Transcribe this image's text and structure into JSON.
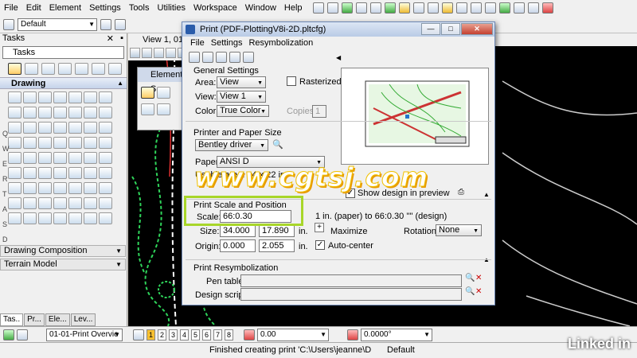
{
  "menubar": {
    "items": [
      "File",
      "Edit",
      "Element",
      "Settings",
      "Tools",
      "Utilities",
      "Workspace",
      "Window",
      "Help"
    ]
  },
  "toolbar": {
    "level_combo": "Default"
  },
  "tasks_panel": {
    "title": "Tasks",
    "combo": "Tasks",
    "section_drawing": "Drawing",
    "section_drawing_composition": "Drawing Composition",
    "section_terrain_model": "Terrain Model",
    "row_letters": [
      "Q",
      "W",
      "E",
      "R",
      "T",
      "A",
      "S",
      "D",
      "F"
    ],
    "tabs": [
      "Tas..",
      "Pr...",
      "Ele...",
      "Lev..."
    ]
  },
  "view": {
    "title": "View 1, 01-0"
  },
  "element_selection": {
    "title": "Element S"
  },
  "print_dialog": {
    "title": "Print  (PDF-PlottingV8i-2D.pltcfg)",
    "menu": [
      "File",
      "Settings",
      "Resymbolization"
    ],
    "general_settings": "General Settings",
    "area_label": "Area:",
    "area_value": "View",
    "rasterized_label": "Rasterized",
    "view_label": "View:",
    "view_value": "View 1",
    "color_label": "Color:",
    "color_value": "True Color",
    "copies_label": "Copies:",
    "copies_value": "1",
    "printer_paper_size": "Printer and Paper Size",
    "driver_value": "Bentley driver",
    "paper_label": "Paper:",
    "paper_value": "ANSI D",
    "usable_area": "Usable area: 34 x 22 in.",
    "show_design": "Show design in preview",
    "print_scale_position": "Print Scale and Position",
    "scale_label": "Scale:",
    "scale_value": "66:0.30",
    "scale_desc": "1 in. (paper) to 66:0.30 '\"' (design)",
    "size_label": "Size:",
    "size_w": "34.000",
    "size_h": "17.890",
    "size_unit": "in.",
    "maximize": "Maximize",
    "rotation_label": "Rotation:",
    "rotation_value": "None",
    "origin_label": "Origin:",
    "origin_x": "0.000",
    "origin_y": "2.055",
    "origin_unit": "in.",
    "auto_center": "Auto-center",
    "print_resymbolization": "Print Resymbolization",
    "pen_table_label": "Pen table:",
    "design_script_label": "Design script:"
  },
  "bottom": {
    "model_combo": "01-01-Print Overvie",
    "view_buttons": [
      "1",
      "2",
      "3",
      "4",
      "5",
      "6",
      "7",
      "8"
    ],
    "field1": "0.00",
    "field2": "0.0000°"
  },
  "status": {
    "message": "Finished creating print 'C:\\Users\\jeanne\\D",
    "level": "Default"
  },
  "watermark": "www.cgtsj.com",
  "brand": "Linked in"
}
